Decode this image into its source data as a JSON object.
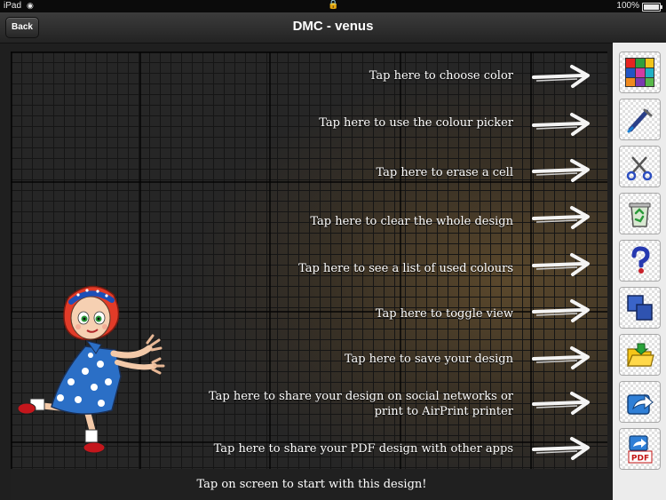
{
  "status_bar": {
    "device": "iPad",
    "battery": "100%"
  },
  "nav": {
    "back_label": "Back",
    "title": "DMC - venus"
  },
  "hints": [
    "Tap here to choose color",
    "Tap here to use the colour picker",
    "Tap here to erase a cell",
    "Tap here to clear the whole design",
    "Tap here to see a list of used colours",
    "Tap here to toggle view",
    "Tap here to save your design",
    "Tap here to share your design on social networks or print to AirPrint printer",
    "Tap here to share your PDF design with other apps"
  ],
  "footer": {
    "text": "Tap on screen to start with this design!"
  },
  "toolbar": {
    "buttons": [
      {
        "icon": "color-palette-icon"
      },
      {
        "icon": "colour-picker-icon"
      },
      {
        "icon": "eraser-scissors-icon"
      },
      {
        "icon": "recycle-bin-icon"
      },
      {
        "icon": "help-question-icon"
      },
      {
        "icon": "toggle-view-icon"
      },
      {
        "icon": "save-folder-icon"
      },
      {
        "icon": "share-icon"
      },
      {
        "icon": "pdf-share-icon"
      }
    ],
    "pdf_label": "PDF"
  }
}
